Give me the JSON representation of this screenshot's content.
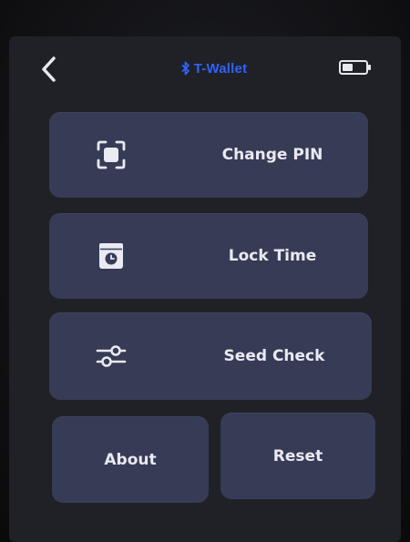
{
  "header": {
    "title": "T-Wallet",
    "back_icon": "chevron-left-icon",
    "bluetooth_icon": "bluetooth-icon",
    "battery_icon": "battery-icon"
  },
  "menu": {
    "change_pin": {
      "label": "Change PIN",
      "icon": "focus-frame-icon"
    },
    "lock_time": {
      "label": "Lock Time",
      "icon": "clock-card-icon"
    },
    "seed_check": {
      "label": "Seed Check",
      "icon": "sliders-icon"
    },
    "about": {
      "label": "About"
    },
    "reset": {
      "label": "Reset"
    }
  },
  "colors": {
    "accent": "#2f62ff",
    "button": "#363b56",
    "screen": "#202126",
    "text": "#e9eaf2"
  }
}
